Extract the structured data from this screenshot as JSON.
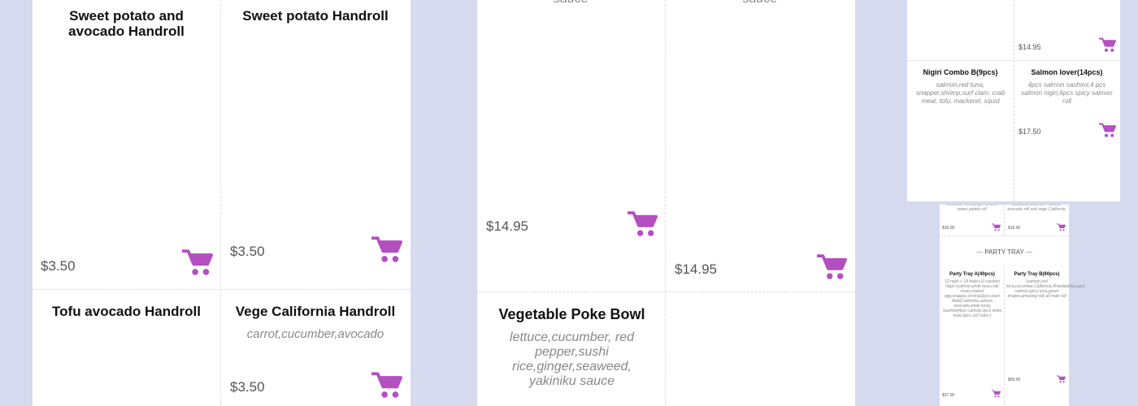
{
  "panel1": {
    "items": [
      {
        "title": "Sweet potato and avocado Handroll",
        "price": "$3.50"
      },
      {
        "title": "Sweet potato Handroll",
        "price": "$3.50"
      },
      {
        "title": "Tofu avocado Handroll"
      },
      {
        "title": "Vege California Handroll",
        "desc": "carrot,cucumber,avocado",
        "price": "$3.50"
      }
    ]
  },
  "panel2": {
    "top_left_desc": "sauce",
    "top_right_desc": "sauce",
    "price_left": "$14.95",
    "price_right": "$14.95",
    "bottom_item": {
      "title": "Vegetable Poke Bowl",
      "desc": "lettuce,cucumber, red pepper,sushi rice,ginger,seaweed, yakiniku sauce"
    }
  },
  "panel3": {
    "top_right_price": "$14.95",
    "items": [
      {
        "title": "Nigiri Combo B(9pcs)",
        "desc": "salmon,red tuna, snapper,shrimp,surf clam, crab meat, tofu, mackerel, squid"
      },
      {
        "title": "Salmon lover(14pcs)",
        "desc": "4pcs salmon sashimi,4 pcs salmon nigiri,6pcs spicy salmon roll",
        "price": "$17.50"
      }
    ]
  },
  "panel4": {
    "top_left_desc": "avocado roll,mango roll and sweet potato roll",
    "top_right_desc": "avocado,cucumber roll,tofu avocado roll and vege California",
    "top_left_price": "$16.00",
    "top_right_price": "$16.00",
    "section_title": "--- PARTY TRAY ---",
    "items": [
      {
        "title": "Party Tray A(40pcs)",
        "desc": "12 nigiri + 18 maki+10 sashimi Nigiri (salmon,white tuna,crab meat,cooked egg,snapper,shrimp)2pcs each Maki(California,salmon avocado,white tuna) Sashimi(4pcs salmon,3pcs white tuna,3pcs surf clam )",
        "price": "$37.00"
      },
      {
        "title": "Party Tray B(60pcs)",
        "desc": "(salmon,red tuna,cucumber,California,Philadelphia,spicy salmon,spicy tuna,green dragon,amazing roll) all maki roll",
        "price": "$59.00"
      }
    ]
  },
  "colors": {
    "accent": "#b44fc0",
    "background": "#d6daef"
  },
  "icons": {
    "cart": "shopping-cart-icon"
  }
}
